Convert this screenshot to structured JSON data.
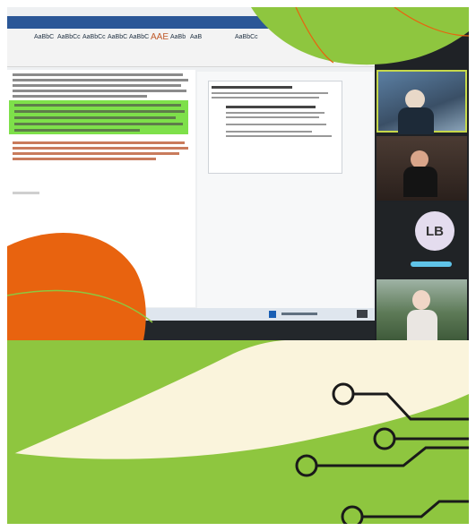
{
  "colors": {
    "accent_green": "#8ec63f",
    "accent_orange": "#e8630f",
    "cream": "#faf4dc",
    "circuit": "#1a1a1a"
  },
  "document": {
    "style_labels": [
      "AaBbC",
      "AaBbCc",
      "AaBbCc",
      "AaBbC",
      "AaBbC",
      "AAE",
      "AaBb",
      "AaB",
      "AaBbCc"
    ]
  },
  "avatar": {
    "initials": "LB"
  },
  "icons": [
    "circuit-icon",
    "video-tile-icon"
  ]
}
